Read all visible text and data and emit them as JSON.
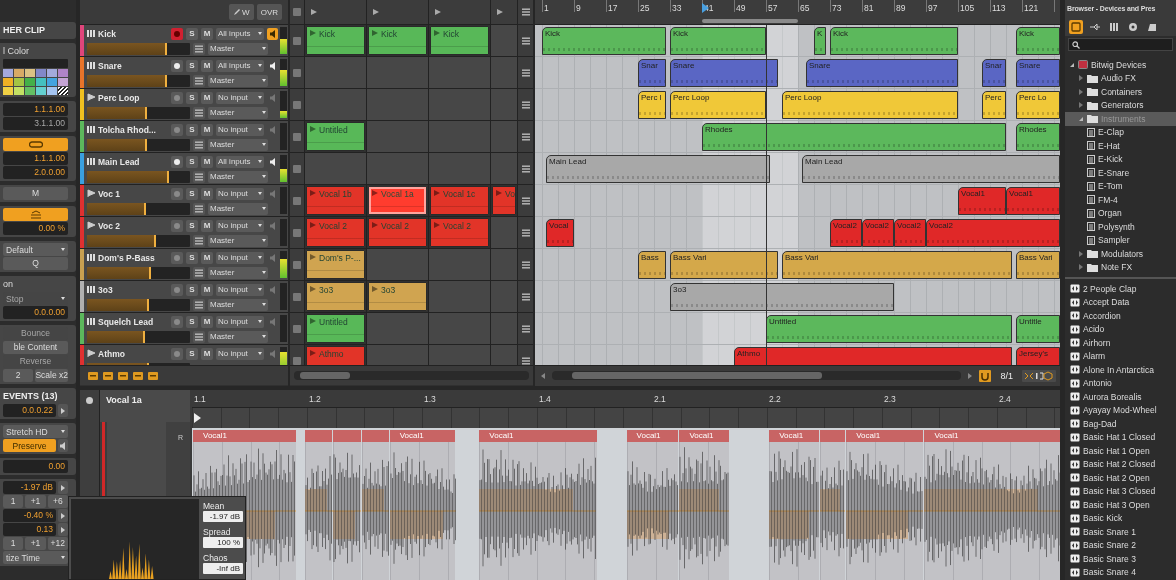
{
  "inspector": {
    "sections": [
      [
        {
          "kind": "heading",
          "text": "HER CLIP"
        }
      ],
      [
        {
          "kind": "label",
          "text": "l Color"
        },
        {
          "kind": "colorbar"
        },
        {
          "kind": "palette",
          "swatches": [
            {
              "color": "#a4a8dc"
            },
            {
              "color": "#d8aa66"
            },
            {
              "color": "#dcc284"
            },
            {
              "color": "#8288c8"
            },
            {
              "color": "#a4aadc"
            },
            {
              "color": "#b084c8"
            },
            {
              "color": "#f0b024"
            },
            {
              "color": "#a4c444"
            },
            {
              "color": "#44b048"
            },
            {
              "color": "#44c0c0"
            },
            {
              "color": "#44a4e0"
            },
            {
              "color": "#c4a4d4"
            },
            {
              "color": "#f0d044"
            },
            {
              "color": "#c4e064"
            },
            {
              "color": "#64c064"
            },
            {
              "color": "#64d0d0"
            },
            {
              "color": "#a4c4f0"
            }
          ]
        }
      ],
      [
        {
          "kind": "value",
          "text": "1.1.1.00",
          "disabled": false
        },
        {
          "kind": "value",
          "text": "3.1.1.00",
          "disabled": true
        }
      ],
      [
        {
          "kind": "loop",
          "on": true
        },
        {
          "kind": "value",
          "text": "1.1.1.00",
          "disabled": false
        },
        {
          "kind": "value",
          "text": "2.0.0.00",
          "disabled": false
        }
      ],
      [
        {
          "kind": "button",
          "text": "M",
          "disabled": false
        }
      ],
      [
        {
          "kind": "switch",
          "on": true
        },
        {
          "kind": "value",
          "text": "0.00 %",
          "disabled": false
        }
      ],
      [
        {
          "kind": "dropdown",
          "text": "Default",
          "disabled": false
        },
        {
          "kind": "button",
          "text": "Q",
          "disabled": false
        }
      ],
      [
        {
          "kind": "label",
          "text": "on"
        },
        {
          "kind": "dropdown",
          "text": "Stop",
          "disabled": true
        },
        {
          "kind": "value",
          "text": "0.0.0.00",
          "disabled": false
        }
      ],
      [
        {
          "kind": "button",
          "text": "Bounce",
          "disabled": true
        },
        {
          "kind": "button",
          "text": "ble Content",
          "disabled": false
        },
        {
          "kind": "button",
          "text": "Reverse",
          "disabled": true
        },
        {
          "kind": "buttons",
          "items": [
            "2",
            "Scale x2"
          ]
        }
      ],
      [
        {
          "kind": "heading",
          "text": "EVENTS (13)"
        },
        {
          "kind": "value",
          "text": "0.0.0.22",
          "disabled": false,
          "arrow": true
        }
      ],
      [
        {
          "kind": "dropdown",
          "text": "Stretch HD",
          "disabled": false
        },
        {
          "kind": "toggle",
          "text": "Preserve",
          "on": true
        }
      ],
      [
        {
          "kind": "value",
          "text": "0.00",
          "disabled": false
        }
      ],
      [
        {
          "kind": "value",
          "text": "-1.97 dB",
          "disabled": false,
          "arrow": true
        },
        {
          "kind": "buttons",
          "items": [
            "1",
            "+1",
            "+6"
          ]
        },
        {
          "kind": "value",
          "text": "-0.40 %",
          "disabled": false,
          "arrow": true
        },
        {
          "kind": "value",
          "text": "0.13",
          "disabled": false,
          "arrow": true
        },
        {
          "kind": "buttons",
          "items": [
            "1",
            "+1",
            "+12"
          ]
        },
        {
          "kind": "dropdown",
          "text": "tize Time",
          "disabled": false
        }
      ]
    ]
  },
  "track_header": {
    "buttons": [
      "W",
      "OVR"
    ]
  },
  "tracks": [
    {
      "name": "Kick",
      "color": "#e0457b",
      "kind": "instrument",
      "armed": true,
      "input_active": true,
      "monitor": true,
      "buttons": [
        "S",
        "M"
      ],
      "input": "All inputs",
      "output": "Master",
      "volume": {
        "level": 0.78
      },
      "meter": {
        "level": 0.55
      }
    },
    {
      "name": "Snare",
      "color": "#e8742a",
      "kind": "instrument",
      "armed": false,
      "input_active": true,
      "monitor": false,
      "buttons": [
        "S",
        "M"
      ],
      "input": "All inputs",
      "output": "Master",
      "volume": {
        "level": 0.78
      },
      "meter": {
        "level": 0.6
      }
    },
    {
      "name": "Perc Loop",
      "color": "#f0c020",
      "kind": "audio",
      "armed": false,
      "input_active": false,
      "monitor": false,
      "buttons": [
        "S",
        "M"
      ],
      "input": "No input",
      "output": "Master",
      "volume": {
        "level": 0.58
      },
      "meter": {
        "level": 0.25
      }
    },
    {
      "name": "Tolcha Rhod...",
      "color": "#5cb85c",
      "kind": "instrument",
      "armed": false,
      "input_active": false,
      "monitor": false,
      "buttons": [
        "S",
        "M"
      ],
      "input": "No input",
      "output": "Master",
      "volume": {
        "level": 0.58
      },
      "meter": {
        "level": 0
      }
    },
    {
      "name": "Main Lead",
      "color": "#3aa0e0",
      "kind": "instrument",
      "armed": false,
      "input_active": true,
      "monitor": false,
      "buttons": [
        "S",
        "M"
      ],
      "input": "All inputs",
      "output": "Master",
      "volume": {
        "level": 0.8
      },
      "meter": {
        "level": 0.5
      }
    },
    {
      "name": "Voc 1",
      "color": "#e03030",
      "kind": "audio",
      "armed": false,
      "input_active": false,
      "monitor": false,
      "buttons": [
        "S",
        "M"
      ],
      "input": "No input",
      "output": "Master",
      "volume": {
        "level": 0.57
      },
      "meter": {
        "level": 0
      }
    },
    {
      "name": "Voc 2",
      "color": "#e03030",
      "kind": "audio",
      "armed": false,
      "input_active": false,
      "monitor": false,
      "buttons": [
        "S",
        "M"
      ],
      "input": "No input",
      "output": "Master",
      "volume": {
        "level": 0.67
      },
      "meter": {
        "level": 0
      }
    },
    {
      "name": "Dom's P-Bass",
      "color": "#c8a050",
      "kind": "instrument",
      "armed": false,
      "input_active": false,
      "monitor": false,
      "buttons": [
        "S",
        "M"
      ],
      "input": "No input",
      "output": "Master",
      "volume": {
        "level": 0.62
      },
      "meter": {
        "level": 0.7
      }
    },
    {
      "name": "3o3",
      "color": "#b0b0b0",
      "kind": "instrument",
      "armed": false,
      "input_active": false,
      "monitor": false,
      "buttons": [
        "S",
        "M"
      ],
      "input": "No input",
      "output": "Master",
      "volume": {
        "level": 0.6
      },
      "meter": {
        "level": 0
      }
    },
    {
      "name": "Squelch Lead",
      "color": "#5cb85c",
      "kind": "instrument",
      "armed": false,
      "input_active": false,
      "monitor": false,
      "buttons": [
        "S",
        "M"
      ],
      "input": "No input",
      "output": "Master",
      "volume": {
        "level": 0.56
      },
      "meter": {
        "level": 0
      }
    },
    {
      "name": "Athmo",
      "color": "#e03030",
      "kind": "audio",
      "armed": false,
      "input_active": false,
      "monitor": false,
      "buttons": [
        "S",
        "M"
      ],
      "input": "No input",
      "volume": {
        "level": 0.6
      },
      "meter": {
        "level": 0.8
      }
    }
  ],
  "clip_launcher": {
    "rows": [
      {
        "slots": [
          {
            "kind": "clip",
            "name": "Kick",
            "color": "#58b858",
            "selected": false
          },
          {
            "kind": "clip",
            "name": "Kick",
            "color": "#58b858",
            "selected": false
          },
          {
            "kind": "clip",
            "name": "Kick",
            "color": "#58b858",
            "selected": false
          },
          {
            "kind": "dot",
            "selected": false
          }
        ]
      },
      {
        "slots": [
          {
            "kind": "empty",
            "selected": false
          },
          {
            "kind": "empty",
            "selected": false
          },
          {
            "kind": "empty",
            "selected": false
          },
          {
            "kind": "empty",
            "selected": false
          }
        ]
      },
      {
        "slots": [
          {
            "kind": "empty",
            "selected": false
          },
          {
            "kind": "empty",
            "selected": false
          },
          {
            "kind": "empty",
            "selected": false
          },
          {
            "kind": "empty",
            "selected": false
          }
        ]
      },
      {
        "slots": [
          {
            "kind": "clip",
            "name": "Untitled",
            "color": "#58b858",
            "selected": false
          },
          {
            "kind": "empty",
            "selected": false
          },
          {
            "kind": "empty",
            "selected": false
          },
          {
            "kind": "empty",
            "selected": false
          }
        ]
      },
      {
        "slots": [
          {
            "kind": "empty",
            "selected": false
          },
          {
            "kind": "empty",
            "selected": false
          },
          {
            "kind": "empty",
            "selected": false
          },
          {
            "kind": "empty",
            "selected": false
          }
        ]
      },
      {
        "slots": [
          {
            "kind": "clip",
            "name": "Vocal 1b",
            "color": "#e23428",
            "selected": false
          },
          {
            "kind": "clip",
            "name": "Vocal 1a",
            "color": "#e23428",
            "selected": true
          },
          {
            "kind": "clip",
            "name": "Vocal 1c",
            "color": "#e23428",
            "selected": false
          },
          {
            "kind": "clip",
            "name": "Vo",
            "color": "#e23428",
            "selected": false
          }
        ]
      },
      {
        "slots": [
          {
            "kind": "clip",
            "name": "Vocal 2",
            "color": "#e23428",
            "selected": false
          },
          {
            "kind": "clip",
            "name": "Vocal 2",
            "color": "#e23428",
            "selected": false
          },
          {
            "kind": "clip",
            "name": "Vocal 2",
            "color": "#e23428",
            "selected": false
          },
          {
            "kind": "empty",
            "selected": false
          }
        ]
      },
      {
        "slots": [
          {
            "kind": "clip",
            "name": "Dom's P-...",
            "color": "#d0a450",
            "selected": false
          },
          {
            "kind": "empty",
            "selected": false
          },
          {
            "kind": "empty",
            "selected": false
          },
          {
            "kind": "empty",
            "selected": false
          }
        ]
      },
      {
        "slots": [
          {
            "kind": "clip",
            "name": "3o3",
            "color": "#d0a450",
            "selected": false
          },
          {
            "kind": "clip",
            "name": "3o3",
            "color": "#d0a450",
            "selected": false
          },
          {
            "kind": "empty",
            "selected": false
          },
          {
            "kind": "empty",
            "selected": false
          }
        ]
      },
      {
        "slots": [
          {
            "kind": "clip",
            "name": "Untitled",
            "color": "#58b858",
            "selected": false
          },
          {
            "kind": "empty",
            "selected": false
          },
          {
            "kind": "empty",
            "selected": false
          },
          {
            "kind": "empty",
            "selected": false
          }
        ]
      },
      {
        "slots": [
          {
            "kind": "clip",
            "name": "Athmo",
            "color": "#e23428",
            "selected": false
          },
          {
            "kind": "empty",
            "selected": false
          },
          {
            "kind": "empty",
            "selected": false
          },
          {
            "kind": "empty",
            "selected": false
          }
        ]
      }
    ]
  },
  "arrangement": {
    "ruler": [
      "1",
      "9",
      "17",
      "25",
      "33",
      "41",
      "49",
      "57",
      "65",
      "73",
      "81",
      "89",
      "97",
      "105",
      "113",
      "121"
    ],
    "zoom": "8/1",
    "lanes": [
      {
        "clips": [
          {
            "name": "Kick",
            "color": "#5cb85c"
          },
          {
            "name": "Kick",
            "color": "#5cb85c"
          },
          {
            "name": "K",
            "color": "#5cb85c"
          },
          {
            "name": "Kick",
            "color": "#5cb85c"
          },
          {
            "name": "Kick",
            "color": "#5cb85c"
          }
        ]
      },
      {
        "clips": [
          {
            "name": "Snar",
            "color": "#5a66c4"
          },
          {
            "name": "Snare",
            "color": "#5a66c4"
          },
          {
            "name": "Snare",
            "color": "#5a66c4"
          },
          {
            "name": "Snar",
            "color": "#5a66c4"
          },
          {
            "name": "Snare",
            "color": "#5a66c4"
          }
        ]
      },
      {
        "clips": [
          {
            "name": "Perc l",
            "color": "#f0c838"
          },
          {
            "name": "Perc Loop",
            "color": "#f0c838"
          },
          {
            "name": "Perc Loop",
            "color": "#f0c838"
          },
          {
            "name": "Perc",
            "color": "#f0c838"
          },
          {
            "name": "Perc Lo",
            "color": "#f0c838"
          }
        ]
      },
      {
        "clips": [
          {
            "name": "Rhodes",
            "color": "#5cb85c"
          },
          {
            "name": "Rhodes",
            "color": "#5cb85c"
          }
        ]
      },
      {
        "clips": [
          {
            "name": "Main Lead",
            "color": "#a8a8a8"
          },
          {
            "name": "Main Lead",
            "color": "#a8a8a8"
          }
        ]
      },
      {
        "clips": [
          {
            "name": "Vocal1",
            "color": "#e02828"
          },
          {
            "name": "Vocal1",
            "color": "#e02828"
          }
        ]
      },
      {
        "clips": [
          {
            "name": "Vocal",
            "color": "#e02828"
          },
          {
            "name": "Vocal2",
            "color": "#e02828"
          },
          {
            "name": "Vocal2",
            "color": "#e02828"
          },
          {
            "name": "Vocal2",
            "color": "#e02828"
          },
          {
            "name": "Vocal2",
            "color": "#e02828"
          }
        ]
      },
      {
        "clips": [
          {
            "name": "Bass",
            "color": "#d4a84a"
          },
          {
            "name": "Bass Vari",
            "color": "#d4a84a"
          },
          {
            "name": "Bass Vari",
            "color": "#d4a84a"
          },
          {
            "name": "Bass Vari",
            "color": "#d4a84a"
          }
        ]
      },
      {
        "clips": [
          {
            "name": "3o3",
            "color": "#a8a8a8"
          }
        ]
      },
      {
        "clips": [
          {
            "name": "Untitled",
            "color": "#5cb85c"
          },
          {
            "name": "Untitle",
            "color": "#5cb85c"
          }
        ]
      },
      {
        "clips": [
          {
            "name": "Athmo",
            "color": "#e02828"
          },
          {
            "name": "Jersey's",
            "color": "#e02828"
          }
        ]
      }
    ]
  },
  "editor": {
    "clip_name": "Vocal 1a",
    "lane_label": "R",
    "ruler": [
      "1.1",
      "1.2",
      "1.3",
      "1.4",
      "2.1",
      "2.2",
      "2.3",
      "2.4"
    ],
    "events": [
      {
        "kind": "named",
        "label": "Vocal1"
      },
      {
        "kind": "plain"
      },
      {
        "kind": "plain"
      },
      {
        "kind": "plain"
      },
      {
        "kind": "named",
        "label": "Vocal1"
      },
      {
        "kind": "named",
        "label": "Vocal1"
      },
      {
        "kind": "named",
        "label": "Vocal1"
      },
      {
        "kind": "named",
        "label": "Vocal1"
      },
      {
        "kind": "named",
        "label": "Vocal1"
      },
      {
        "kind": "plain"
      },
      {
        "kind": "named",
        "label": "Vocal1"
      },
      {
        "kind": "named",
        "label": "Vocal1"
      }
    ]
  },
  "popup": {
    "fields": [
      {
        "label": "Mean",
        "value": "-1.97 dB"
      },
      {
        "label": "Spread",
        "value": "100 %"
      },
      {
        "label": "Chaos",
        "value": "-Inf dB"
      }
    ]
  },
  "browser": {
    "title": "Browser - Devices and Pres",
    "tabs": [
      {
        "selected": true
      },
      {
        "selected": false
      },
      {
        "selected": false
      },
      {
        "selected": false
      },
      {
        "selected": false
      }
    ],
    "tree": [
      {
        "name": "Bitwig Devices",
        "expanded": true,
        "selected": false,
        "children": [
          {
            "name": "Audio FX",
            "expanded": false,
            "selected": false
          },
          {
            "name": "Containers",
            "expanded": false,
            "selected": false
          },
          {
            "name": "Generators",
            "expanded": false,
            "selected": false
          },
          {
            "name": "Instruments",
            "expanded": true,
            "selected": true,
            "children": [
              {
                "name": "E-Clap",
                "selected": false
              },
              {
                "name": "E-Hat",
                "selected": false
              },
              {
                "name": "E-Kick",
                "selected": false
              },
              {
                "name": "E-Snare",
                "selected": false
              },
              {
                "name": "E-Tom",
                "selected": false
              },
              {
                "name": "FM-4",
                "selected": false
              },
              {
                "name": "Organ",
                "selected": false
              },
              {
                "name": "Polysynth",
                "selected": false
              },
              {
                "name": "Sampler",
                "selected": false
              }
            ]
          },
          {
            "name": "Modulators",
            "expanded": false,
            "selected": false
          },
          {
            "name": "Note FX",
            "expanded": false,
            "selected": false
          }
        ]
      }
    ],
    "presets": [
      "2 People Clap",
      "Accept Data",
      "Accordion",
      "Acido",
      "Airhorn",
      "Alarm",
      "Alone In Antarctica",
      "Antonio",
      "Aurora Borealis",
      "Ayayay Mod-Wheel",
      "Bag-Dad",
      "Basic Hat 1 Closed",
      "Basic Hat 1 Open",
      "Basic Hat 2 Closed",
      "Basic Hat 2 Open",
      "Basic Hat 3 Closed",
      "Basic Hat 3 Open",
      "Basic Kick",
      "Basic Snare 1",
      "Basic Snare 2",
      "Basic Snare 3",
      "Basic Snare 4"
    ]
  }
}
